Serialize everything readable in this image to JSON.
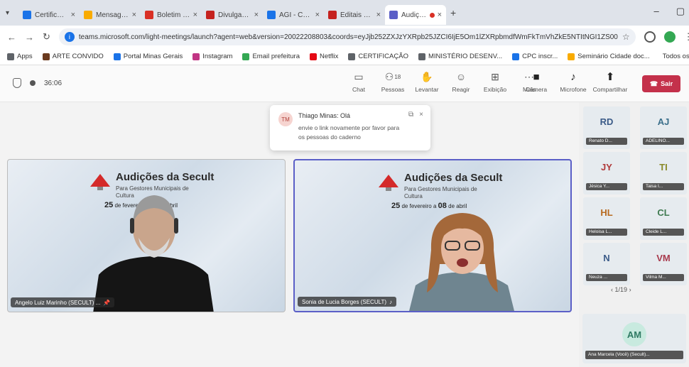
{
  "browser": {
    "tabs": [
      {
        "title": "Certificado Con...",
        "color": "#1a73e8"
      },
      {
        "title": "Mensagens Recor...",
        "color": "#f9ab00"
      },
      {
        "title": "Boletim e Avaliaçã...",
        "color": "#d93025"
      },
      {
        "title": "Divulgação de Editai...",
        "color": "#c5221f"
      },
      {
        "title": "AGI - Calendário ...",
        "color": "#1a73e8"
      },
      {
        "title": "Editais de seleção ...",
        "color": "#c5221f"
      },
      {
        "title": "Audições Secult",
        "color": "#5b5fc7",
        "active": true
      }
    ],
    "url": "teams.microsoft.com/light-meetings/launch?agent=web&version=20022208803&coords=eyJjb252ZXJzYXRpb25JZCI6IjE5Om1lZXRpbmdfWmFkTmVhZkE5NTItNGI1ZS00",
    "bookmarks": [
      {
        "label": "Apps",
        "color": "#5f6368"
      },
      {
        "label": "ARTE CONVIDO",
        "color": "#6b3a1f"
      },
      {
        "label": "Portal Minas Gerais",
        "color": "#1a73e8"
      },
      {
        "label": "Instagram",
        "color": "#c13584"
      },
      {
        "label": "Email prefeitura",
        "color": "#34a853"
      },
      {
        "label": "Netflix",
        "color": "#e50914"
      },
      {
        "label": "CERTIFICAÇÃO",
        "color": "#5f6368"
      },
      {
        "label": "MINISTÉRIO DESENV...",
        "color": "#5f6368"
      },
      {
        "label": "CPC inscr...",
        "color": "#1a73e8"
      },
      {
        "label": "Seminário Cidade doc...",
        "color": "#f9ab00"
      }
    ],
    "bookmarks_all": "Todos os favoritos"
  },
  "teams": {
    "timer": "36:06",
    "tools": [
      {
        "label": "Chat",
        "icon": "chat-icon",
        "glyph": "▭"
      },
      {
        "label": "Pessoas",
        "icon": "people-icon",
        "glyph": "⚇",
        "badge": "18"
      },
      {
        "label": "Levantar",
        "icon": "raise-hand-icon",
        "glyph": "✋"
      },
      {
        "label": "Reagir",
        "icon": "react-icon",
        "glyph": "☺"
      },
      {
        "label": "Exibição",
        "icon": "view-icon",
        "glyph": "⊞"
      },
      {
        "label": "Mais",
        "icon": "more-icon",
        "glyph": "⋯"
      }
    ],
    "media": [
      {
        "label": "Câmera",
        "icon": "camera-icon",
        "glyph": "■"
      },
      {
        "label": "Microfone",
        "icon": "microphone-icon",
        "glyph": "♪"
      },
      {
        "label": "Compartilhar",
        "icon": "share-icon",
        "glyph": "⬆"
      }
    ],
    "leave_label": "Sair"
  },
  "toast": {
    "initials": "TM",
    "name": "Thiago Minas: Olá",
    "message": "envie o link novamente por favor para os pessoas do caderno"
  },
  "slide": {
    "title": "Audições da Secult",
    "subtitle": "Para Gestores Municipais de Cultura",
    "date_a": "25",
    "date_text_a": "de fevereiro a 08 de abril",
    "date_b": "25",
    "date_text_b": "de fevereiro a",
    "date_b2": "08",
    "date_text_b2": "de abril"
  },
  "videos": [
    {
      "name": "Angelo Luiz Marinho (SECULT) ..."
    },
    {
      "name": "Sonia de Lucia Borges (SECULT)"
    }
  ],
  "participants": [
    {
      "initials": "RD",
      "label": "Renato D...",
      "color": "#3b5b88"
    },
    {
      "initials": "AJ",
      "label": "ADELINO...",
      "color": "#3b6f8a"
    },
    {
      "initials": "JY",
      "label": "Jésica Y...",
      "color": "#b03a3a"
    },
    {
      "initials": "TI",
      "label": "Taisa I...",
      "color": "#8a8a2a"
    },
    {
      "initials": "HL",
      "label": "Heloisa L...",
      "color": "#b86a1f"
    },
    {
      "initials": "CL",
      "label": "Cleide L...",
      "color": "#3f7a50"
    },
    {
      "initials": "N",
      "label": "Neuza ...",
      "color": "#3b5b88"
    },
    {
      "initials": "VM",
      "label": "Vilma M...",
      "color": "#a83a4d"
    }
  ],
  "pager": "1/19",
  "self": {
    "initials": "AM",
    "label": "Ana Marcela (Você) (Secult)..."
  }
}
